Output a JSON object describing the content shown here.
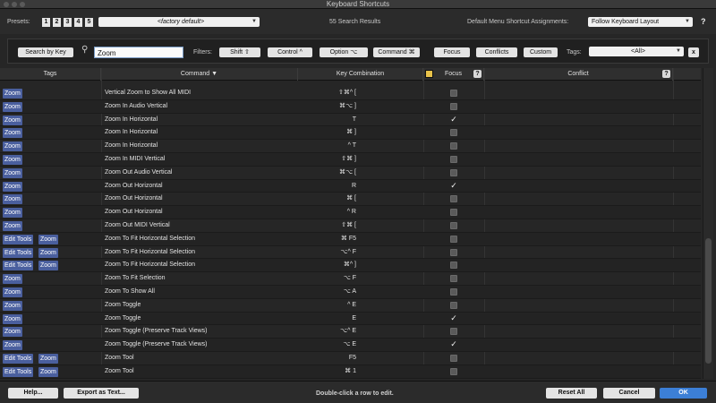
{
  "window": {
    "title": "Keyboard Shortcuts"
  },
  "presets": {
    "label": "Presets:",
    "numbers": [
      "1",
      "2",
      "3",
      "4",
      "5"
    ],
    "dropdown_value": "<factory default>"
  },
  "results_count": "55 Search Results",
  "menu_assignments": {
    "label": "Default Menu Shortcut Assignments:",
    "dropdown_value": "Follow Keyboard Layout",
    "help": "?"
  },
  "filter": {
    "search_by_key_label": "Search by Key",
    "search_value": "Zoom",
    "filters_label": "Filters:",
    "shift_label": "Shift ⇧",
    "control_label": "Control ^",
    "option_label": "Option ⌥",
    "command_label": "Command ⌘",
    "focus_label": "Focus",
    "conflicts_label": "Conflicts",
    "custom_label": "Custom",
    "tags_label": "Tags:",
    "tags_dropdown_value": "<All>",
    "clear_label": "x"
  },
  "columns": {
    "tags": "Tags",
    "command": "Command ▼",
    "key": "Key Combination",
    "focus": "Focus",
    "conflict": "Conflict",
    "help": "?"
  },
  "rows": [
    {
      "tags": [
        "Zoom"
      ],
      "command": "Vertical Zoom to Show All MIDI",
      "key": "⇧⌘^ [",
      "focus": false
    },
    {
      "tags": [
        "Zoom"
      ],
      "command": "Zoom In Audio Vertical",
      "key": "⌘⌥ ]",
      "focus": false
    },
    {
      "tags": [
        "Zoom"
      ],
      "command": "Zoom In Horizontal",
      "key": "T",
      "focus": true
    },
    {
      "tags": [
        "Zoom"
      ],
      "command": "Zoom In Horizontal",
      "key": "⌘ ]",
      "focus": false
    },
    {
      "tags": [
        "Zoom"
      ],
      "command": "Zoom In Horizontal",
      "key": "^ T",
      "focus": false
    },
    {
      "tags": [
        "Zoom"
      ],
      "command": "Zoom In MIDI Vertical",
      "key": "⇧⌘ ]",
      "focus": false
    },
    {
      "tags": [
        "Zoom"
      ],
      "command": "Zoom Out Audio Vertical",
      "key": "⌘⌥ [",
      "focus": false
    },
    {
      "tags": [
        "Zoom"
      ],
      "command": "Zoom Out Horizontal",
      "key": "R",
      "focus": true
    },
    {
      "tags": [
        "Zoom"
      ],
      "command": "Zoom Out Horizontal",
      "key": "⌘ [",
      "focus": false
    },
    {
      "tags": [
        "Zoom"
      ],
      "command": "Zoom Out Horizontal",
      "key": "^ R",
      "focus": false
    },
    {
      "tags": [
        "Zoom"
      ],
      "command": "Zoom Out MIDI Vertical",
      "key": "⇧⌘ [",
      "focus": false
    },
    {
      "tags": [
        "Edit Tools",
        "Zoom"
      ],
      "command": "Zoom To Fit Horizontal Selection",
      "key": "⌘ F5",
      "focus": false
    },
    {
      "tags": [
        "Edit Tools",
        "Zoom"
      ],
      "command": "Zoom To Fit Horizontal Selection",
      "key": "⌥^ F",
      "focus": false
    },
    {
      "tags": [
        "Edit Tools",
        "Zoom"
      ],
      "command": "Zoom To Fit Horizontal Selection",
      "key": "⌘^ ]",
      "focus": false
    },
    {
      "tags": [
        "Zoom"
      ],
      "command": "Zoom To Fit Selection",
      "key": "⌥ F",
      "focus": false
    },
    {
      "tags": [
        "Zoom"
      ],
      "command": "Zoom To Show All",
      "key": "⌥ A",
      "focus": false
    },
    {
      "tags": [
        "Zoom"
      ],
      "command": "Zoom Toggle",
      "key": "^ E",
      "focus": false
    },
    {
      "tags": [
        "Zoom"
      ],
      "command": "Zoom Toggle",
      "key": "E",
      "focus": true
    },
    {
      "tags": [
        "Zoom"
      ],
      "command": "Zoom Toggle (Preserve Track Views)",
      "key": "⌥^ E",
      "focus": false
    },
    {
      "tags": [
        "Zoom"
      ],
      "command": "Zoom Toggle (Preserve Track Views)",
      "key": "⌥ E",
      "focus": true
    },
    {
      "tags": [
        "Edit Tools",
        "Zoom"
      ],
      "command": "Zoom Tool",
      "key": "F5",
      "focus": false
    },
    {
      "tags": [
        "Edit Tools",
        "Zoom"
      ],
      "command": "Zoom Tool",
      "key": "⌘ 1",
      "focus": false
    }
  ],
  "bottom": {
    "help_label": "Help...",
    "export_label": "Export as Text...",
    "hint": "Double-click a row to edit.",
    "reset_label": "Reset All",
    "cancel_label": "Cancel",
    "ok_label": "OK"
  }
}
